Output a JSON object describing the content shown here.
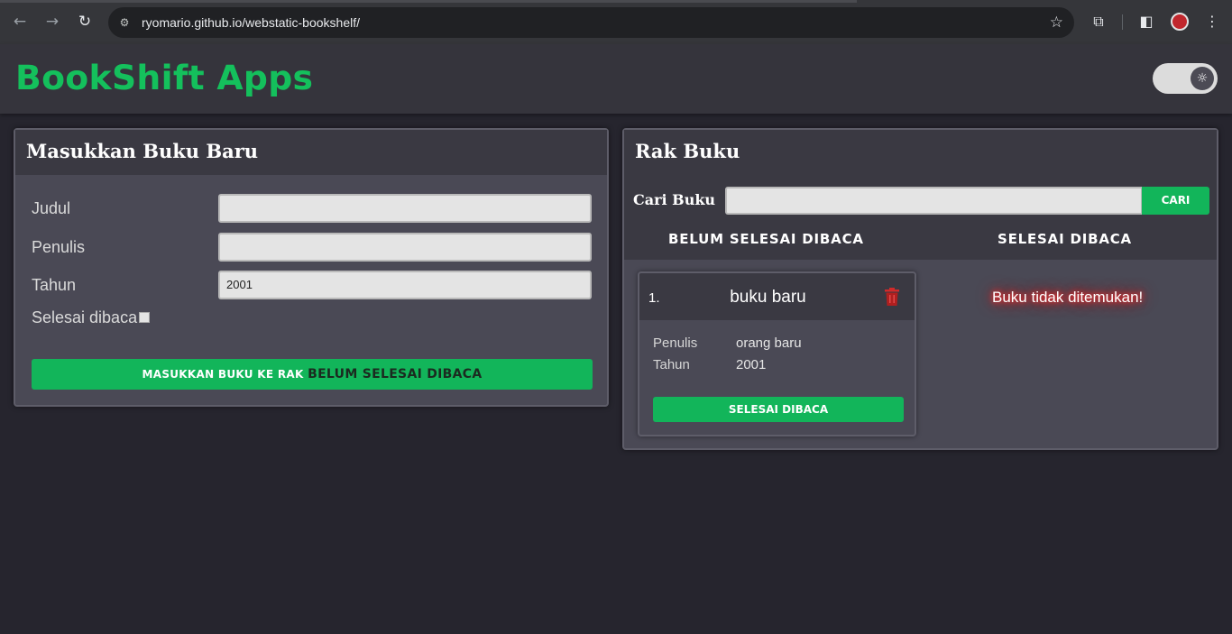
{
  "browser": {
    "url": "ryomario.github.io/webstatic-bookshelf/",
    "icons": [
      "back-icon",
      "forward-icon",
      "reload-icon",
      "site-settings-icon",
      "bookmark-star-icon",
      "extensions-icon",
      "sidepanel-icon",
      "profile-icon",
      "menu-icon"
    ]
  },
  "header": {
    "title": "BookShift Apps"
  },
  "input_panel": {
    "title": "Masukkan Buku Baru",
    "title_label": "Judul",
    "title_value": "",
    "author_label": "Penulis",
    "author_value": "",
    "year_label": "Tahun",
    "year_value": "2001",
    "complete_label": "Selesai dibaca",
    "submit_prefix": "MASUKKAN BUKU KE RAK",
    "submit_target": "BELUM SELESAI DIBACA"
  },
  "shelf_panel": {
    "title": "Rak Buku",
    "search_label": "Cari Buku",
    "search_value": "",
    "search_button": "CARI",
    "col_incomplete": "BELUM SELESAI DIBACA",
    "col_complete": "SELESAI DIBACA",
    "incomplete_books": [
      {
        "index": "1.",
        "title": "buku baru",
        "author_label": "Penulis",
        "author": "orang baru",
        "year_label": "Tahun",
        "year": "2001",
        "action": "SELESAI DIBACA"
      }
    ],
    "complete_empty_message": "Buku tidak ditemukan!"
  },
  "colors": {
    "accent": "#12b55a",
    "danger": "#d12a2a"
  }
}
